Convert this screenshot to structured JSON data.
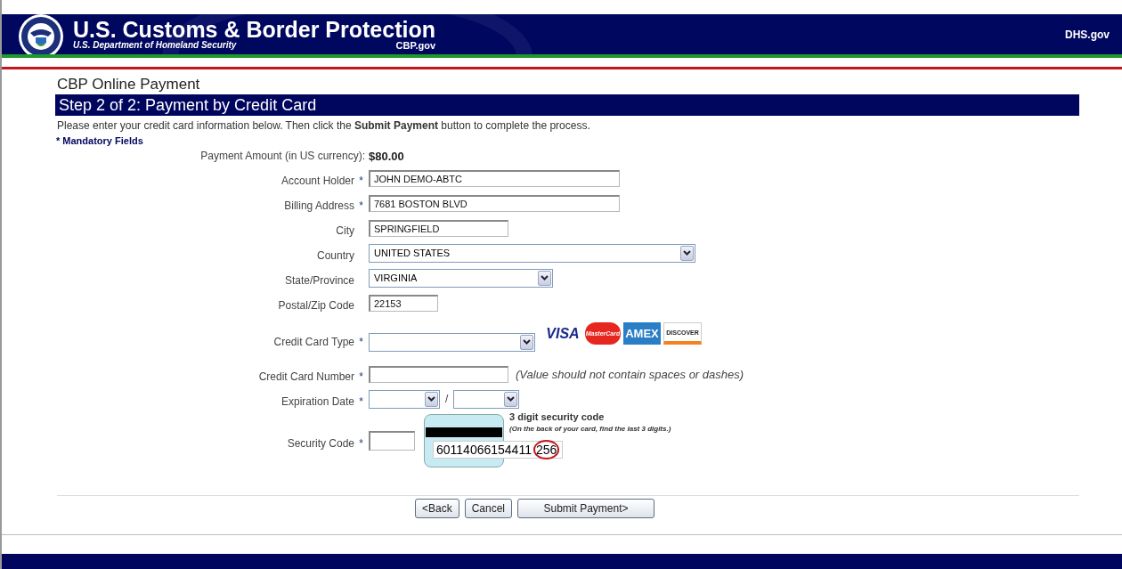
{
  "header": {
    "title": "U.S. Customs & Border Protection",
    "subtitle": "U.S. Department of Homeland Security",
    "site": "CBP.gov",
    "link": "DHS.gov"
  },
  "page_title": "CBP Online Payment",
  "step_title": "Step 2 of 2: Payment by Credit Card",
  "instructions": "Please enter your credit card information below. Then click the **Submit Payment** button to complete the process.",
  "mandatory_note": "* Mandatory Fields",
  "fields": [
    {
      "kind": "amount",
      "label": "Payment Amount (in US currency):",
      "value": "$80.00"
    },
    {
      "kind": "text",
      "label": "Account Holder",
      "required_mark": "*",
      "value": "JOHN DEMO-ABTC"
    },
    {
      "kind": "text",
      "label": "Billing Address",
      "required_mark": "*",
      "value": "7681 BOSTON BLVD"
    },
    {
      "kind": "text",
      "label": "City",
      "value": "SPRINGFIELD"
    },
    {
      "kind": "select",
      "label": "Country",
      "value": "UNITED STATES"
    },
    {
      "kind": "select",
      "label": "State/Province",
      "value": "VIRGINIA"
    },
    {
      "kind": "text",
      "label": "Postal/Zip Code",
      "value": "22153"
    },
    {
      "kind": "cardtype",
      "label": "Credit Card Type",
      "required_mark": "*",
      "logos": [
        "VISA",
        "MasterCard",
        "AMEX",
        "DISCOVER"
      ]
    },
    {
      "kind": "text",
      "label": "Credit Card Number",
      "required_mark": "*",
      "hint": "(Value should not contain spaces or dashes)"
    },
    {
      "kind": "date",
      "label": "Expiration Date",
      "required_mark": "*",
      "separator": "/"
    },
    {
      "kind": "security",
      "label": "Security Code",
      "required_mark": "*",
      "help_title": "3 digit security code",
      "help_text": "(On the back of your card, find the last 3 digits.)",
      "sample_number": "60114066154411",
      "sample_code": "256"
    }
  ],
  "buttons": [
    "<Back",
    "Cancel",
    "Submit Payment>"
  ]
}
